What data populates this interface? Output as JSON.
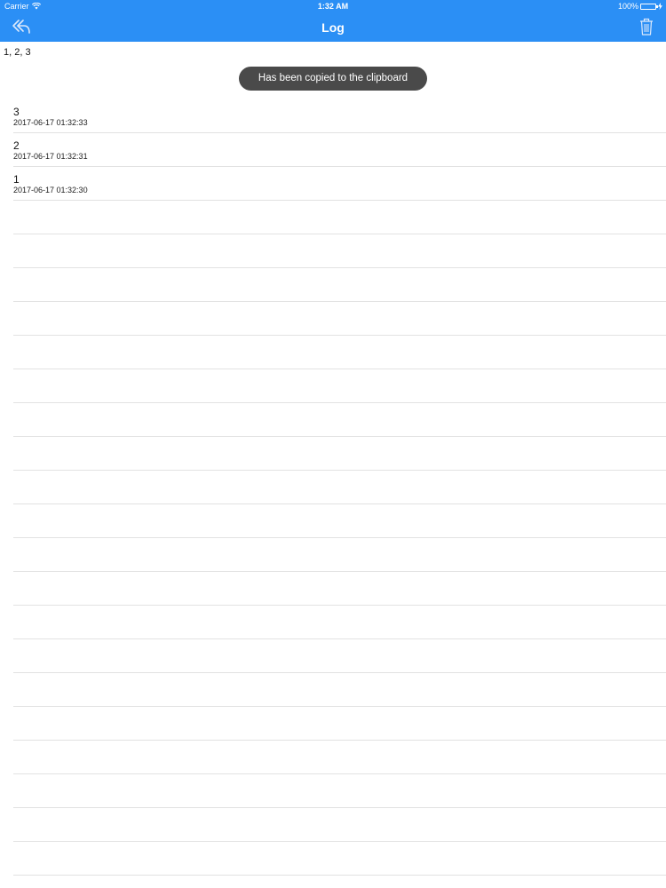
{
  "status_bar": {
    "carrier": "Carrier",
    "time": "1:32 AM",
    "battery_text": "100%",
    "battery_level": 1.0
  },
  "nav": {
    "title": "Log",
    "back_icon": "back-arrow-icon",
    "trash_icon": "trash-icon",
    "color": "#2b8ff5"
  },
  "summary": "1, 2, 3",
  "toast": "Has been copied to the clipboard",
  "log": [
    {
      "value": "3",
      "time": "2017-06-17 01:32:33"
    },
    {
      "value": "2",
      "time": "2017-06-17 01:32:31"
    },
    {
      "value": "1",
      "time": "2017-06-17 01:32:30"
    }
  ]
}
